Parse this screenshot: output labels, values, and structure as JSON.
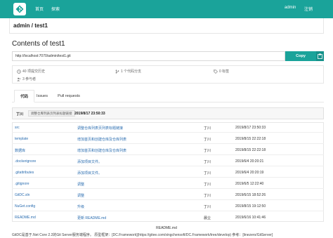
{
  "nav": {
    "home_label": "首页",
    "explore_label": "探索",
    "user_label": "admin",
    "logout_label": "注销",
    "color": "#1aa39a"
  },
  "repo": {
    "breadcrumb": "admin / test1",
    "contents_title": "Contents of test1",
    "clone_url": "http://localhost:7070/admin/test1.git",
    "copy_label": "Copy"
  },
  "stats": {
    "commits": "40 项提交历史",
    "branches": "1 个代码分支",
    "tags": "0 标签",
    "contributors": "3 参与者"
  },
  "tabs": [
    {
      "label": "代码"
    },
    {
      "label": "Issues"
    },
    {
      "label": "Pull requests"
    }
  ],
  "latest_commit": {
    "author": "丁川",
    "message": "调整仓库列表页列表标题链接",
    "date": "2019/8/17 23:50:33"
  },
  "files": [
    {
      "name": "src",
      "message": "调整仓库列表页列表标题链接",
      "author": "丁川",
      "date": "2019/8/17 23:50:33"
    },
    {
      "name": "template",
      "message": "增加首页和创建仓库及仓库列表",
      "author": "丁川",
      "date": "2019/8/15 22:22:18"
    },
    {
      "name": "数据库",
      "message": "增加首页和创建仓库及仓库列表",
      "author": "丁川",
      "date": "2019/8/15 22:22:18"
    },
    {
      "name": ".dockerignore",
      "message": "添加项目文件。",
      "author": "丁川",
      "date": "2019/6/4 20:20:21"
    },
    {
      "name": ".gitattributes",
      "message": "添加项目文件。",
      "author": "丁川",
      "date": "2019/6/4 20:20:19"
    },
    {
      "name": ".gitignore",
      "message": "调整",
      "author": "丁川",
      "date": "2019/6/5 12:22:40"
    },
    {
      "name": "GitDC.sln",
      "message": "调整",
      "author": "丁川",
      "date": "2019/6/15 18:52:26"
    },
    {
      "name": "NuGet.config",
      "message": "升级",
      "author": "丁川",
      "date": "2019/8/15 19:12:50"
    },
    {
      "name": "README.md",
      "message": "更新 README.md",
      "author": "晨尘",
      "date": "2019/6/16 10:41:46"
    }
  ],
  "readme": {
    "title": "README.md",
    "text": "GitDC是基于.Net Core 2.2的Git Server服务端程序。 原型框架：[DC.Framework](https://gitee.com/xingchensoft/DC.Framework/tree/develop) 参考：[linezero/GitServer]"
  }
}
